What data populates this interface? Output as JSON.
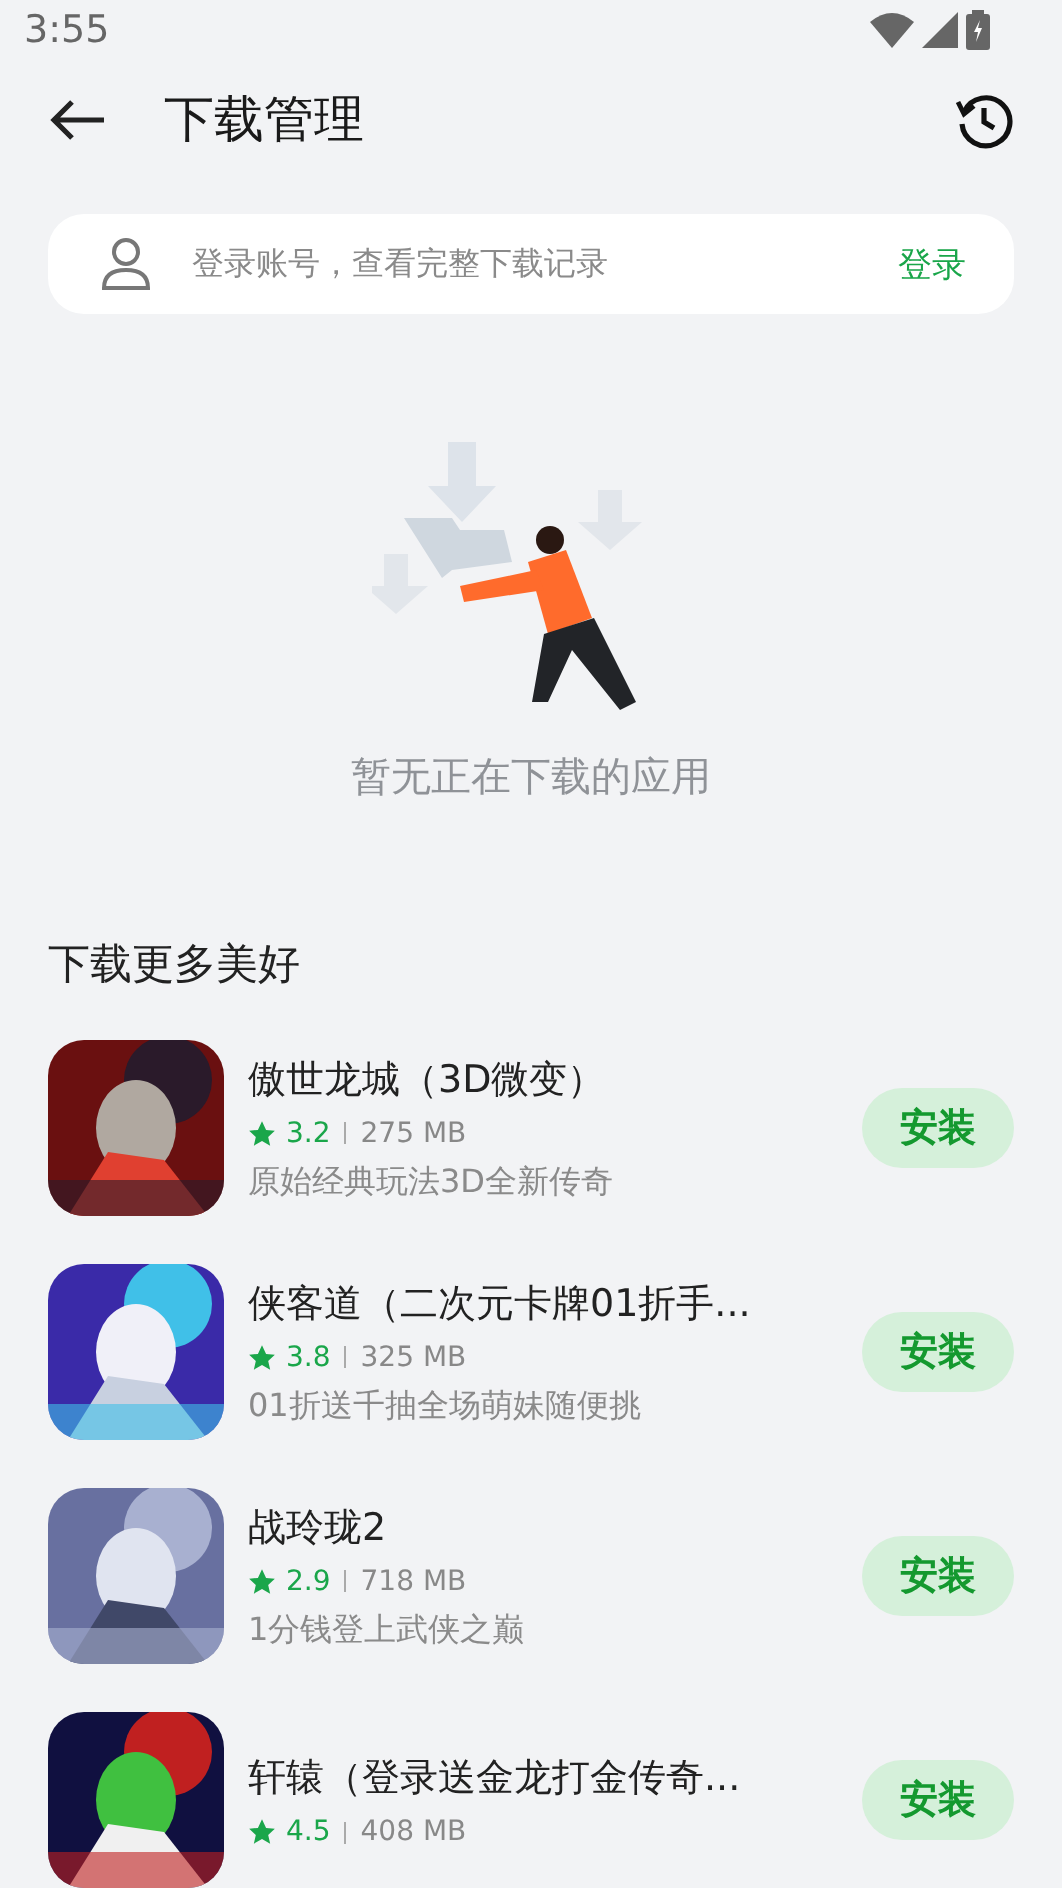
{
  "status_bar": {
    "time": "3:55"
  },
  "header": {
    "title": "下载管理"
  },
  "login_card": {
    "message": "登录账号，查看完整下载记录",
    "action": "登录"
  },
  "empty_state": {
    "kind": "picture",
    "message": "暂无正在下载的应用"
  },
  "section": {
    "title": "下载更多美好"
  },
  "apps": [
    {
      "name": "傲世龙城（3D微变）",
      "rating": "3.2",
      "size": "275 MB",
      "description": "原始经典玩法3D全新传奇",
      "button": "安装",
      "kind": "picture"
    },
    {
      "name": "侠客道（二次元卡牌01折手...",
      "rating": "3.8",
      "size": "325 MB",
      "description": "01折送千抽全场萌妹随便挑",
      "button": "安装",
      "kind": "picture"
    },
    {
      "name": "战玲珑2",
      "rating": "2.9",
      "size": "718 MB",
      "description": "1分钱登上武侠之巅",
      "button": "安装",
      "kind": "picture"
    },
    {
      "name": "轩辕（登录送金龙打金传奇...",
      "rating": "4.5",
      "size": "408 MB",
      "button": "安装",
      "kind": "picture"
    }
  ]
}
